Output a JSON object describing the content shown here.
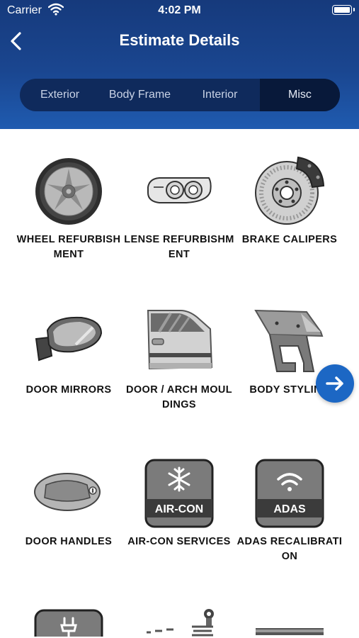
{
  "status_bar": {
    "carrier": "Carrier",
    "time": "4:02 PM"
  },
  "nav": {
    "title": "Estimate Details",
    "back_icon": "chevron-left-icon"
  },
  "tabs": [
    {
      "label": "Exterior",
      "active": false
    },
    {
      "label": "Body Frame",
      "active": false
    },
    {
      "label": "Interior",
      "active": false
    },
    {
      "label": "Misc",
      "active": true
    }
  ],
  "items": [
    {
      "label": "WHEEL REFURBISHMENT",
      "icon": "wheel-icon"
    },
    {
      "label": "LENSE REFURBISHMENT",
      "icon": "headlight-icon"
    },
    {
      "label": "BRAKE CALIPERS",
      "icon": "brake-disc-icon"
    },
    {
      "label": "DOOR MIRRORS",
      "icon": "side-mirror-icon"
    },
    {
      "label": "DOOR / ARCH MOULDINGS",
      "icon": "car-door-icon"
    },
    {
      "label": "BODY STYLING",
      "icon": "spoiler-icon"
    },
    {
      "label": "DOOR HANDLES",
      "icon": "door-handle-icon"
    },
    {
      "label": "AIR-CON SERVICES",
      "icon": "air-con-icon",
      "badge": "AIR-CON"
    },
    {
      "label": "ADAS RECALIBRATION",
      "icon": "adas-icon",
      "badge": "ADAS"
    }
  ],
  "colors": {
    "header": "#1a4690",
    "accent": "#1c67c4"
  },
  "fab_icon": "arrow-right-icon"
}
